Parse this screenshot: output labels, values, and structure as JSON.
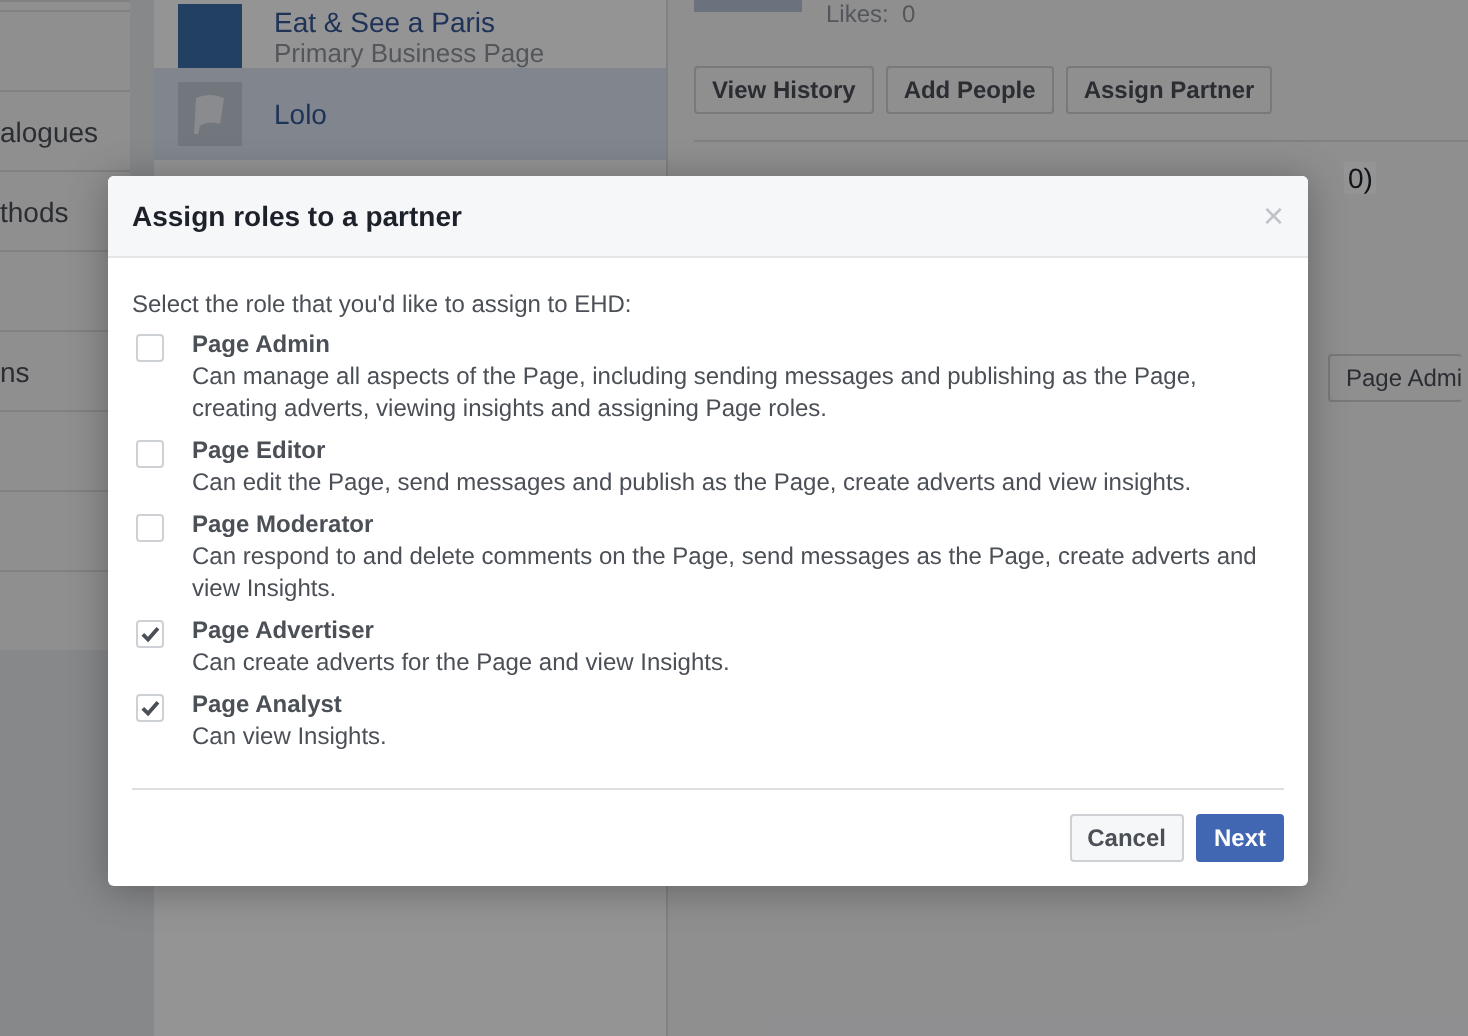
{
  "left_menu": {
    "items": [
      "alogues",
      "thods",
      "ns"
    ]
  },
  "pages_list": [
    {
      "name": "Eat & See a Paris",
      "subtitle": "Primary Business Page",
      "kind": "photo",
      "selected": false
    },
    {
      "name": "Lolo",
      "kind": "flag",
      "selected": true
    }
  ],
  "page_header": {
    "likes_label": "Likes:",
    "likes_value": "0",
    "buttons": [
      "View History",
      "Add People",
      "Assign Partner"
    ],
    "tab": "0)",
    "role_button": "Page Admi"
  },
  "dialog": {
    "title": "Assign roles to a partner",
    "close": "×",
    "prompt": "Select the role that you'd like to assign to EHD:",
    "roles": [
      {
        "name": "Page Admin",
        "description": "Can manage all aspects of the Page, including sending messages and publishing as the Page, creating adverts, viewing insights and assigning Page roles.",
        "checked": false
      },
      {
        "name": "Page Editor",
        "description": "Can edit the Page, send messages and publish as the Page, create adverts and view insights.",
        "checked": false
      },
      {
        "name": "Page Moderator",
        "description": "Can respond to and delete comments on the Page, send messages as the Page, create adverts and view Insights.",
        "checked": false
      },
      {
        "name": "Page Advertiser",
        "description": "Can create adverts for the Page and view Insights.",
        "checked": true
      },
      {
        "name": "Page Analyst",
        "description": "Can view Insights.",
        "checked": true
      }
    ],
    "buttons": [
      {
        "label": "Cancel",
        "kind": "secondary"
      },
      {
        "label": "Next",
        "kind": "primary"
      }
    ]
  }
}
